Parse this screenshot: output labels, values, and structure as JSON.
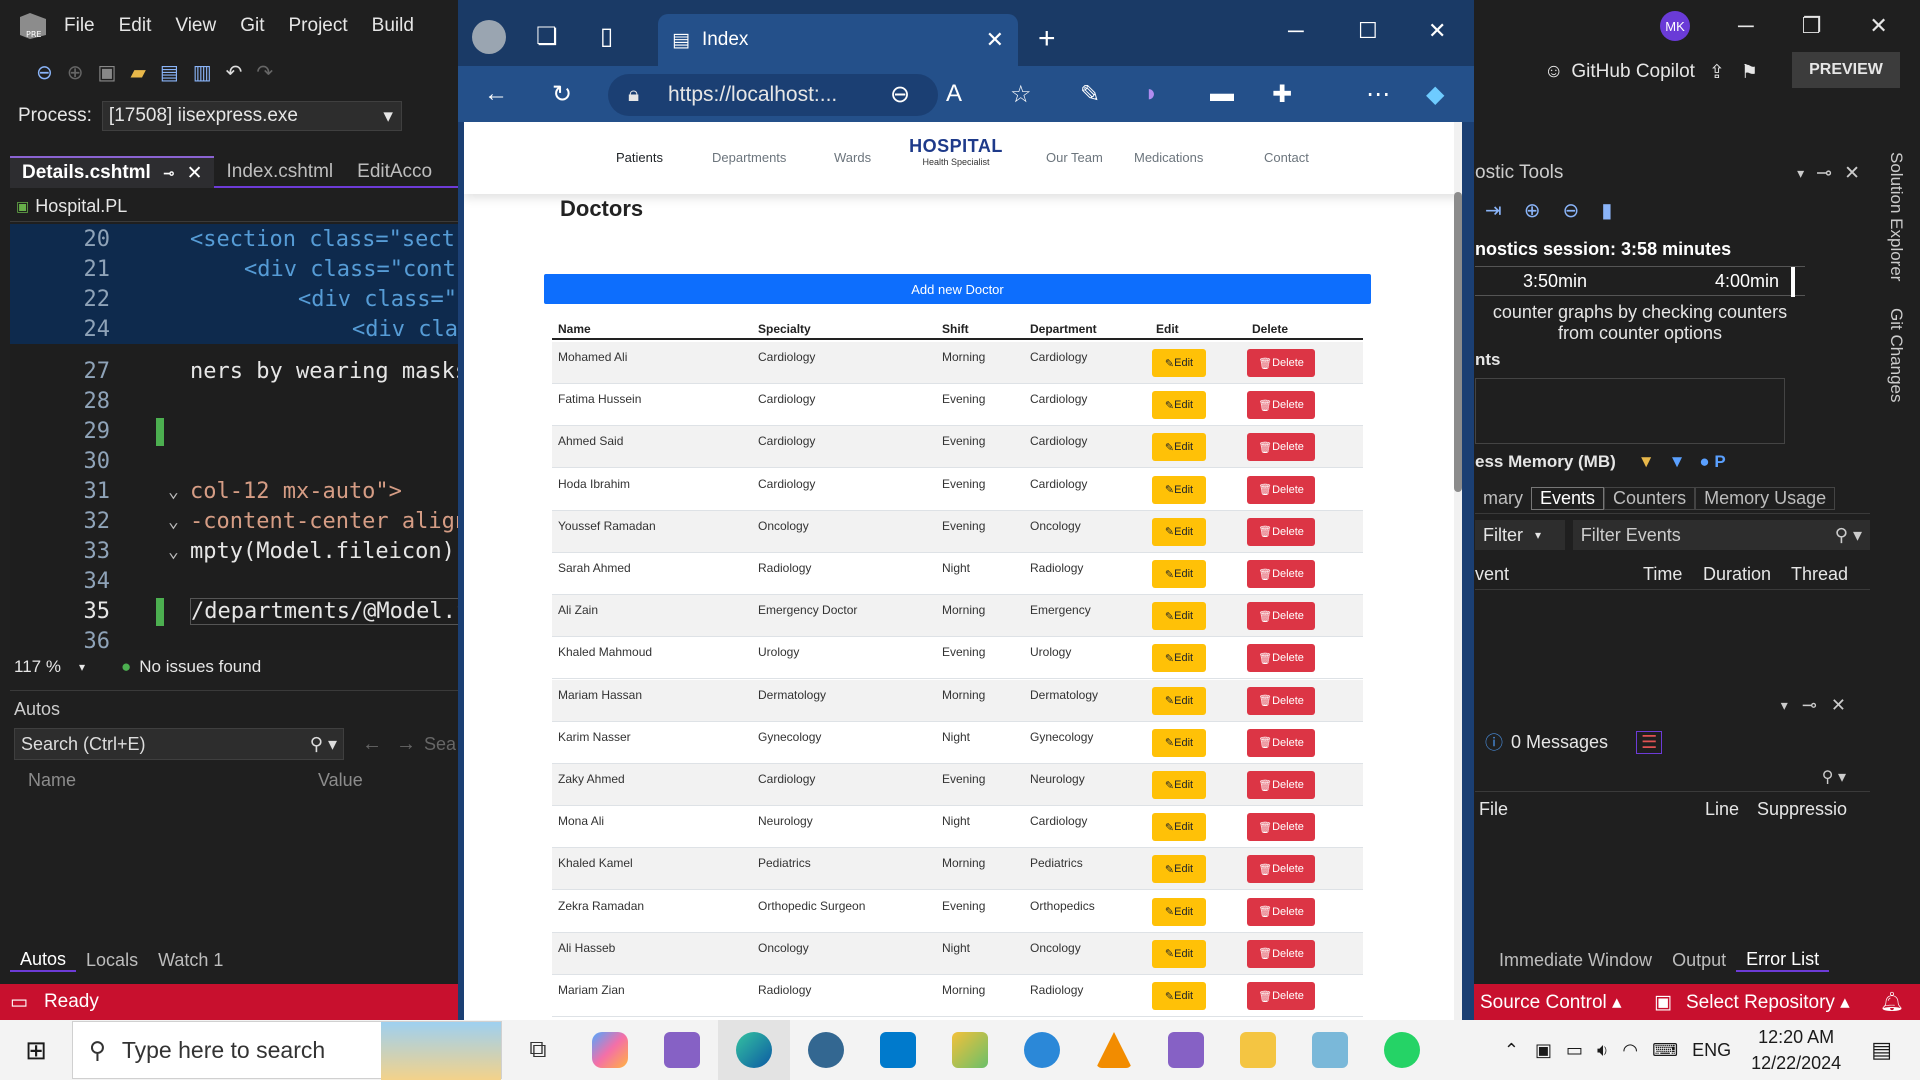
{
  "vs": {
    "menu": [
      "File",
      "Edit",
      "View",
      "Git",
      "Project",
      "Build"
    ],
    "process_label": "Process:",
    "process_value": "[17508] iisexpress.exe",
    "tabs": [
      "Details.cshtml",
      "Index.cshtml",
      "EditAcco"
    ],
    "file_project": "Hospital.PL",
    "zoom": "117 %",
    "issues": "No issues found",
    "autos_title": "Autos",
    "autos_search": "Search (Ctrl+E)",
    "autos_search_hint": "Sea",
    "autos_col_name": "Name",
    "autos_col_value": "Value",
    "bottom_tabs": [
      "Autos",
      "Locals",
      "Watch 1"
    ],
    "status_ready": "Ready",
    "source_control": "Source Control",
    "select_repo": "Select Repository",
    "user_initials": "MK",
    "copilot": "GitHub Copilot",
    "preview": "PREVIEW",
    "code_lines": [
      {
        "n": "20",
        "text": "<section class=\"sect"
      },
      {
        "n": "21",
        "text": "<div class=\"cont"
      },
      {
        "n": "22",
        "text": "<div class=\""
      },
      {
        "n": "24",
        "text": "<div cla"
      },
      {
        "n": "27",
        "text": "ners by wearing masks"
      },
      {
        "n": "28",
        "text": ""
      },
      {
        "n": "29",
        "text": ""
      },
      {
        "n": "30",
        "text": ""
      },
      {
        "n": "31",
        "text": "col-12 mx-auto\">"
      },
      {
        "n": "32",
        "text": "-content-center align"
      },
      {
        "n": "33",
        "text": "mpty(Model.fileicon))"
      },
      {
        "n": "34",
        "text": ""
      },
      {
        "n": "35",
        "text": "/departments/@Model.f"
      },
      {
        "n": "36",
        "text": ""
      }
    ],
    "diag": {
      "title": "ostic Tools",
      "session": "nostics session: 3:58 minutes",
      "t1": "3:50min",
      "t2": "4:00min",
      "hint": "counter graphs by checking counters from counter options",
      "section": "nts",
      "memory": "ess Memory (MB)",
      "tabs": [
        "mary",
        "Events",
        "Counters",
        "Memory Usage"
      ],
      "filter": "Filter",
      "filter_events": "Filter Events",
      "cols": [
        "vent",
        "Time",
        "Duration",
        "Thread"
      ],
      "vert1": "Solution Explorer",
      "vert2": "Git Changes"
    },
    "errlist": {
      "messages": "0 Messages",
      "cols": [
        "File",
        "Line",
        "Suppressio"
      ]
    },
    "right_bottom_tabs": [
      "Immediate Window",
      "Output",
      "Error List"
    ]
  },
  "browser": {
    "tab_title": "Index",
    "url": "https://localhost:...",
    "nav": [
      "Patients",
      "Departments",
      "Wards",
      "Our Team",
      "Medications",
      "Contact"
    ],
    "brand": "HOSPITAL",
    "brand_sub": "Health Specialist",
    "heading": "Doctors",
    "add_button": "Add new Doctor",
    "columns": [
      "Name",
      "Specialty",
      "Shift",
      "Department",
      "Edit",
      "Delete"
    ],
    "edit_label": "Edit",
    "delete_label": "Delete",
    "rows": [
      [
        "Mohamed Ali",
        "Cardiology",
        "Morning",
        "Cardiology"
      ],
      [
        "Fatima Hussein",
        "Cardiology",
        "Evening",
        "Cardiology"
      ],
      [
        "Ahmed Said",
        "Cardiology",
        "Evening",
        "Cardiology"
      ],
      [
        "Hoda Ibrahim",
        "Cardiology",
        "Evening",
        "Cardiology"
      ],
      [
        "Youssef Ramadan",
        "Oncology",
        "Evening",
        "Oncology"
      ],
      [
        "Sarah Ahmed",
        "Radiology",
        "Night",
        "Radiology"
      ],
      [
        "Ali Zain",
        "Emergency Doctor",
        "Morning",
        "Emergency"
      ],
      [
        "Khaled Mahmoud",
        "Urology",
        "Evening",
        "Urology"
      ],
      [
        "Mariam Hassan",
        "Dermatology",
        "Morning",
        "Dermatology"
      ],
      [
        "Karim Nasser",
        "Gynecology",
        "Night",
        "Gynecology"
      ],
      [
        "Zaky Ahmed",
        "Cardiology",
        "Evening",
        "Neurology"
      ],
      [
        "Mona Ali",
        "Neurology",
        "Night",
        "Cardiology"
      ],
      [
        "Khaled Kamel",
        "Pediatrics",
        "Morning",
        "Pediatrics"
      ],
      [
        "Zekra Ramadan",
        "Orthopedic Surgeon",
        "Evening",
        "Orthopedics"
      ],
      [
        "Ali Hasseb",
        "Oncology",
        "Night",
        "Oncology"
      ],
      [
        "Mariam Zian",
        "Radiology",
        "Morning",
        "Radiology"
      ]
    ]
  },
  "taskbar": {
    "search_placeholder": "Type here to search",
    "language": "ENG",
    "time": "12:20 AM",
    "date": "12/22/2024"
  }
}
